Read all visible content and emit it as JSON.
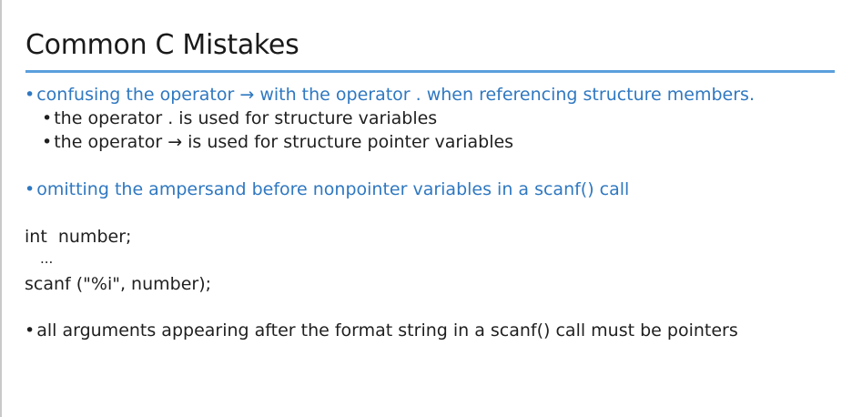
{
  "slide": {
    "title": "Common C Mistakes",
    "bullet_glyph": "•",
    "point1": {
      "text": "confusing the operator → with the operator . when referencing structure members.",
      "sub": [
        "the operator . is used for structure variables",
        "the operator → is used for structure pointer variables"
      ]
    },
    "point2": {
      "text": "omitting the ampersand before nonpointer variables in a scanf() call"
    },
    "code": {
      "line1": "int  number;",
      "line2": "...",
      "line3": "scanf (\"%i\", number);"
    },
    "point3": {
      "text": "all arguments appearing after the format string in a scanf() call must be pointers"
    },
    "colors": {
      "accent_blue": "#2f78c1",
      "underline_blue": "#5aa0dc",
      "text_dark": "#1f1f1f"
    }
  }
}
